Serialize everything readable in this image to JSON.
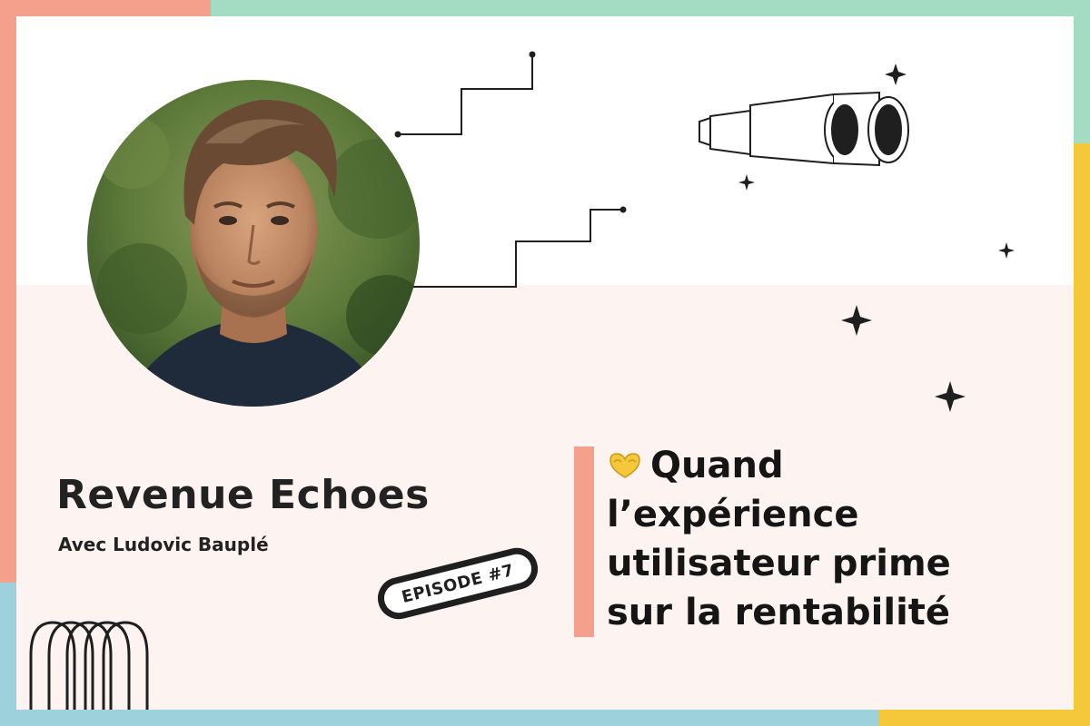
{
  "colors": {
    "frame_top": "#a3dcc2",
    "frame_right": "#f5c73b",
    "frame_bottom": "#9dd1dc",
    "frame_left": "#f4a08c",
    "frame_corner_left_top": "#f4a08c",
    "lower_panel": "#fdf3f0",
    "accent_bar": "#f4a08c",
    "heart": "#f5c73b",
    "ink": "#1f1f1f"
  },
  "show": {
    "title": "Revenue Echoes",
    "subtitle": "Avec Ludovic Bauplé"
  },
  "badge": {
    "label": "EPISODE #7"
  },
  "headline": {
    "icon": "heart-hands-icon",
    "lines": [
      "Quand",
      "l’expérience",
      "utilisateur prime",
      "sur la rentabilité"
    ]
  },
  "decor": {
    "icons": [
      "staircase-line-icon",
      "binoculars-icon",
      "sparkle-star-icon",
      "arches-icon"
    ]
  }
}
